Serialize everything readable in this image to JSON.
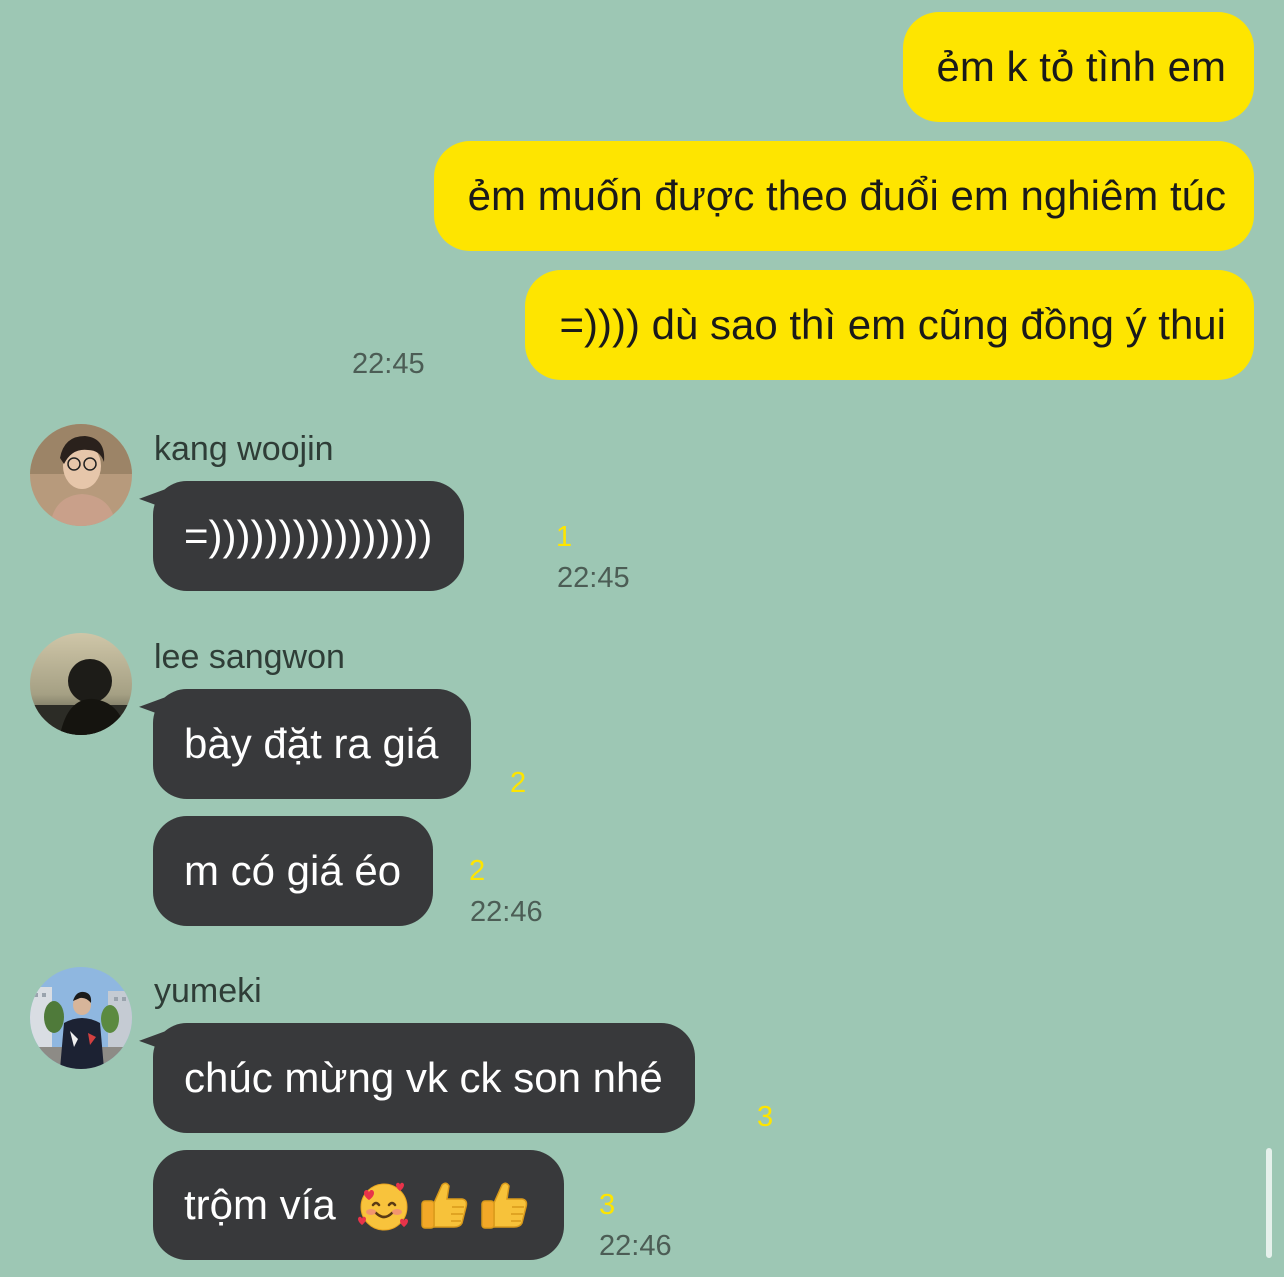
{
  "outgoing": {
    "messages": [
      {
        "text": "ẻm k tỏ tình em"
      },
      {
        "text": "ẻm muốn được theo đuổi em nghiêm túc"
      },
      {
        "text": "=)))) dù sao thì em cũng đồng ý thui"
      }
    ],
    "time": "22:45"
  },
  "groups": [
    {
      "sender": "kang woojin",
      "messages": [
        {
          "text": "=))))))))))))))))",
          "unread": "1"
        }
      ],
      "time": "22:45"
    },
    {
      "sender": "lee sangwon",
      "messages": [
        {
          "text": "bày đặt ra giá",
          "unread": "2"
        },
        {
          "text": "m có giá éo",
          "unread": "2"
        }
      ],
      "time": "22:46"
    },
    {
      "sender": "yumeki",
      "messages": [
        {
          "text": "chúc mừng vk ck son nhé",
          "unread": "3"
        },
        {
          "text": "trộm vía",
          "unread": "3",
          "emojis": [
            "smiling-face-with-hearts-emoji",
            "thumbs-up-emoji",
            "thumbs-up-emoji"
          ]
        }
      ],
      "time": "22:46"
    }
  ],
  "colors": {
    "background": "#9dc7b4",
    "outgoing_bubble": "#fee500",
    "incoming_bubble": "#38393b",
    "unread_count": "#fee500"
  }
}
